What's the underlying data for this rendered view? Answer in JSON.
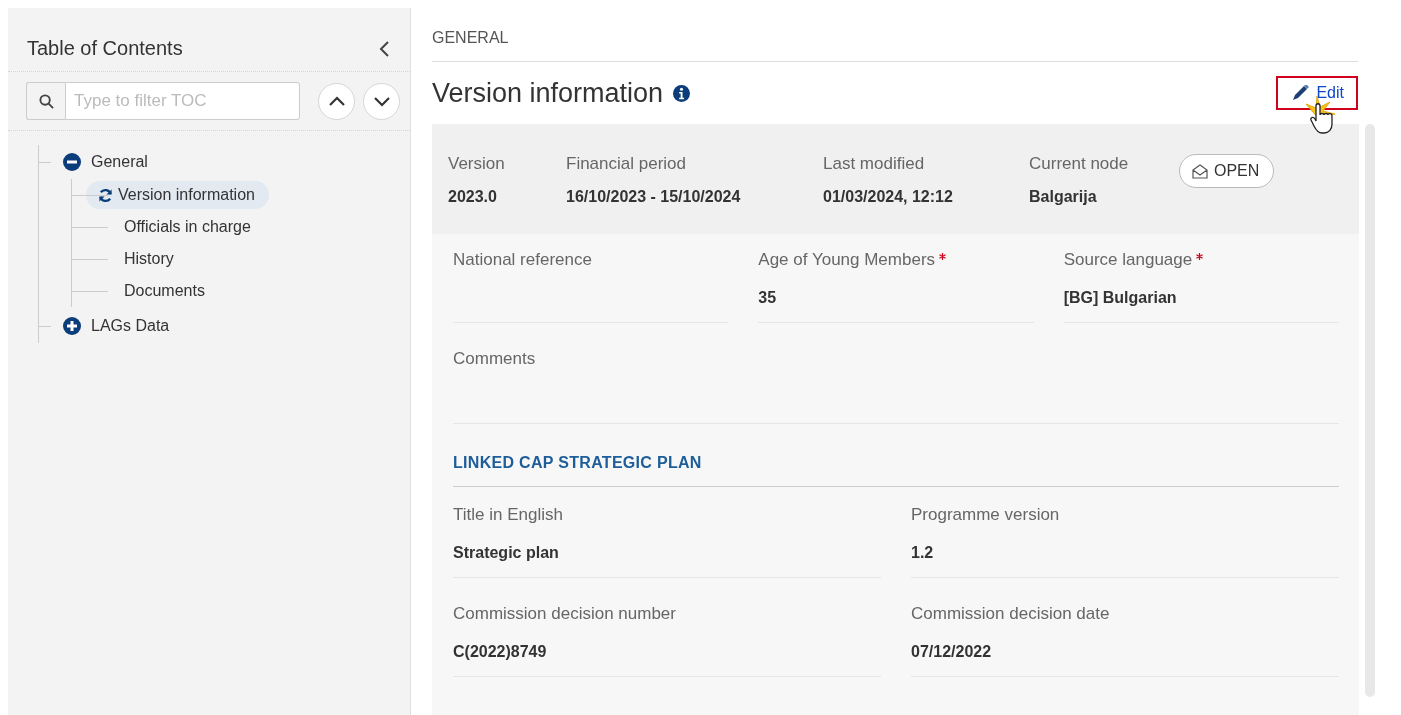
{
  "sidebar": {
    "title": "Table of Contents",
    "filter": {
      "placeholder": "Type to filter TOC"
    },
    "tree": [
      {
        "label": "General",
        "expanded": true,
        "selected": false,
        "children": [
          {
            "label": "Version information",
            "selected": true
          },
          {
            "label": "Officials in charge",
            "selected": false
          },
          {
            "label": "History",
            "selected": false
          },
          {
            "label": "Documents",
            "selected": false
          }
        ]
      },
      {
        "label": "LAGs Data",
        "expanded": false,
        "selected": false
      }
    ]
  },
  "main": {
    "breadcrumb": "GENERAL",
    "title": "Version information",
    "edit_button": "Edit",
    "summary": [
      {
        "label": "Version",
        "value": "2023.0"
      },
      {
        "label": "Financial period",
        "value": "16/10/2023 - 15/10/2024"
      },
      {
        "label": "Last modified",
        "value": "01/03/2024, 12:12"
      },
      {
        "label": "Current node",
        "value": "Balgarija"
      }
    ],
    "status": "OPEN",
    "fields": [
      {
        "label": "National reference",
        "required": false
      },
      {
        "label": "Age of Young Members",
        "value": "35",
        "required": true
      },
      {
        "label": "Source language",
        "value": "[BG] Bulgarian",
        "required": true
      }
    ],
    "comments": {
      "label": "Comments"
    },
    "linked_section": {
      "title": "LINKED CAP STRATEGIC PLAN",
      "fields": [
        {
          "label": "Title in English",
          "value": "Strategic plan"
        },
        {
          "label": "Programme version",
          "value": "1.2"
        },
        {
          "label": "Commission decision number",
          "value": "C(2022)8749"
        },
        {
          "label": "Commission decision date",
          "value": "07/12/2022"
        }
      ]
    }
  }
}
